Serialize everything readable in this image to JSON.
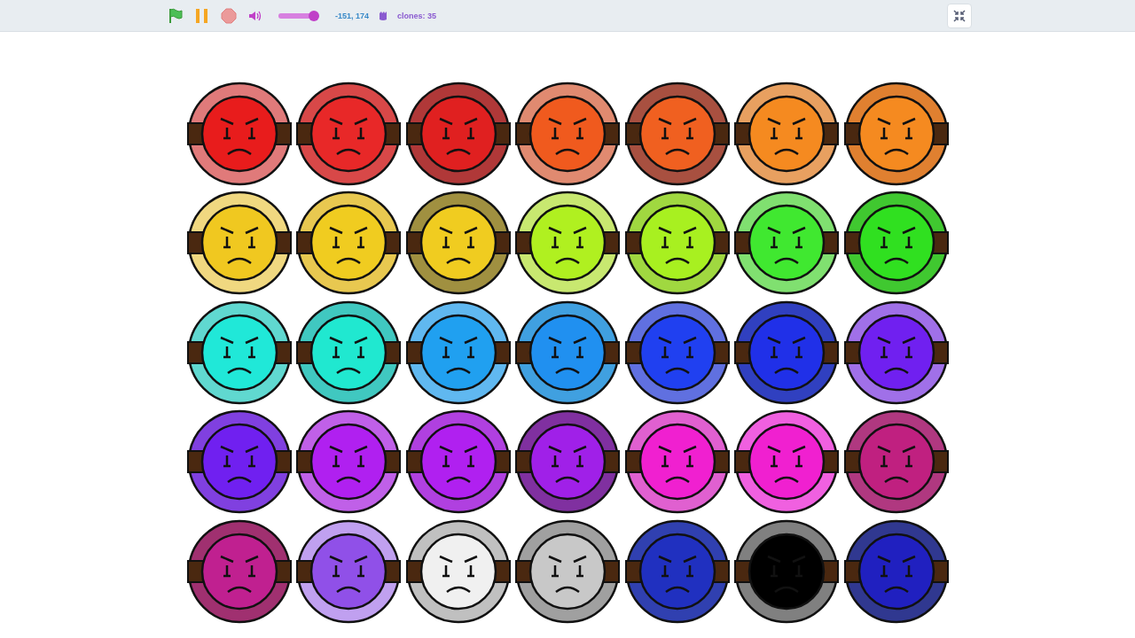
{
  "toolbar": {
    "volume": {
      "level": 1
    },
    "mouse_position": "-151, 174",
    "clones": "clones: 35"
  },
  "stage": {
    "faces": [
      {
        "color": "#e81c1c",
        "ring": {
          "color": "#e07a7a"
        }
      },
      {
        "color": "#e82828",
        "ring": {
          "color": "#d84848"
        }
      },
      {
        "color": "#e02020",
        "ring": {
          "color": "#b03838"
        }
      },
      {
        "color": "#f05a1e",
        "ring": {
          "color": "#e08a70"
        }
      },
      {
        "color": "#f06020",
        "ring": {
          "color": "#a85040"
        }
      },
      {
        "color": "#f58a20",
        "ring": {
          "color": "#e8a060"
        }
      },
      {
        "color": "#f58a20",
        "ring": {
          "color": "#e08030"
        }
      },
      {
        "color": "#f0c820",
        "ring": {
          "color": "#f0d880"
        }
      },
      {
        "color": "#f0cc20",
        "ring": {
          "color": "#e8c850"
        }
      },
      {
        "color": "#f0cc20",
        "ring": {
          "color": "#a09040"
        }
      },
      {
        "color": "#b0f020",
        "ring": {
          "color": "#c8e870"
        }
      },
      {
        "color": "#a8f020",
        "ring": {
          "color": "#a0d840"
        }
      },
      {
        "color": "#40e830",
        "ring": {
          "color": "#80e070"
        }
      },
      {
        "color": "#30e020",
        "ring": {
          "color": "#40c830"
        }
      },
      {
        "color": "#20e8d8",
        "ring": {
          "color": "#60d8d0"
        }
      },
      {
        "color": "#20e8d0",
        "ring": {
          "color": "#40c8c0"
        }
      },
      {
        "color": "#20a0f0",
        "ring": {
          "color": "#60b8f0"
        }
      },
      {
        "color": "#2090f0",
        "ring": {
          "color": "#40a0e0"
        }
      },
      {
        "color": "#2040f0",
        "ring": {
          "color": "#6070e0"
        }
      },
      {
        "color": "#2030e8",
        "ring": {
          "color": "#3040c0"
        }
      },
      {
        "color": "#7020f0",
        "ring": {
          "color": "#a070e8"
        }
      },
      {
        "color": "#7020f0",
        "ring": {
          "color": "#8040e0"
        }
      },
      {
        "color": "#b020f0",
        "ring": {
          "color": "#c060e8"
        }
      },
      {
        "color": "#b020f0",
        "ring": {
          "color": "#b040e0"
        }
      },
      {
        "color": "#a020e8",
        "ring": {
          "color": "#8030a0"
        }
      },
      {
        "color": "#f020d0",
        "ring": {
          "color": "#e060d0"
        }
      },
      {
        "color": "#f020d0",
        "ring": {
          "color": "#f060e0"
        }
      },
      {
        "color": "#c02080",
        "ring": {
          "color": "#b03880"
        }
      },
      {
        "color": "#c02090",
        "ring": {
          "color": "#a03070"
        }
      },
      {
        "color": "#9050e8",
        "ring": {
          "color": "#c0a0f0"
        }
      },
      {
        "color": "#f0f0f0",
        "ring": {
          "color": "#c0c0c0"
        }
      },
      {
        "color": "#c8c8c8",
        "ring": {
          "color": "#a0a0a0"
        }
      },
      {
        "color": "#2030c0",
        "ring": {
          "color": "#3040b0"
        }
      },
      {
        "color": "#000000",
        "ring": {
          "color": "#808080"
        }
      },
      {
        "color": "#2020c0",
        "ring": {
          "color": "#303890"
        }
      }
    ]
  }
}
